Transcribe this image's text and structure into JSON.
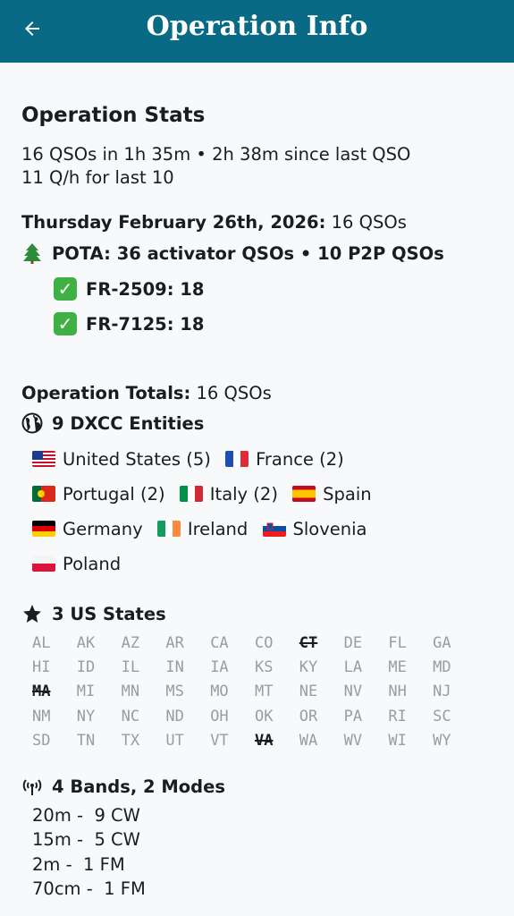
{
  "appbar": {
    "title": "Operation Info",
    "back_icon": "arrow-left-icon",
    "color": "#086a84"
  },
  "stats": {
    "title": "Operation Stats",
    "line1": "16 QSOs in 1h 35m • 2h 38m since last QSO",
    "line2": "11 Q/h for last 10"
  },
  "day": {
    "date_label": "Thursday February 26th, 2026:",
    "date_count": " 16 QSOs",
    "pota_icon": "evergreen-tree-icon",
    "pota_line": "POTA: 36 activator QSOs • 10 P2P QSOs",
    "parks": [
      {
        "label": "FR-2509: 18",
        "icon": "check-mark-icon"
      },
      {
        "label": "FR-7125: 18",
        "icon": "check-mark-icon"
      }
    ]
  },
  "totals": {
    "label": "Operation Totals:",
    "count": " 16 QSOs"
  },
  "dxcc": {
    "icon": "globe-icon",
    "title": "9 DXCC Entities",
    "entities": [
      {
        "name": "United States (5)",
        "flag": "us"
      },
      {
        "name": "France (2)",
        "flag": "fr"
      },
      {
        "name": "Portugal (2)",
        "flag": "pt"
      },
      {
        "name": "Italy (2)",
        "flag": "it"
      },
      {
        "name": "Spain",
        "flag": "es"
      },
      {
        "name": "Germany",
        "flag": "de"
      },
      {
        "name": "Ireland",
        "flag": "ie"
      },
      {
        "name": "Slovenia",
        "flag": "si"
      },
      {
        "name": "Poland",
        "flag": "pl"
      }
    ]
  },
  "us_states": {
    "icon": "star-icon",
    "title": "3 US States",
    "states": [
      "AL",
      "AK",
      "AZ",
      "AR",
      "CA",
      "CO",
      "CT",
      "DE",
      "FL",
      "GA",
      "HI",
      "ID",
      "IL",
      "IN",
      "IA",
      "KS",
      "KY",
      "LA",
      "ME",
      "MD",
      "MA",
      "MI",
      "MN",
      "MS",
      "MO",
      "MT",
      "NE",
      "NV",
      "NH",
      "NJ",
      "NM",
      "NY",
      "NC",
      "ND",
      "OH",
      "OK",
      "OR",
      "PA",
      "RI",
      "SC",
      "SD",
      "TN",
      "TX",
      "UT",
      "VT",
      "VA",
      "WA",
      "WV",
      "WI",
      "WY"
    ],
    "worked": [
      "CT",
      "MA",
      "VA"
    ]
  },
  "bands": {
    "icon": "radio-tower-icon",
    "title": "4 Bands, 2 Modes",
    "lines": [
      "20m -  9 CW",
      "15m -  5 CW",
      "2m -  1 FM",
      "70cm -  1 FM"
    ]
  }
}
